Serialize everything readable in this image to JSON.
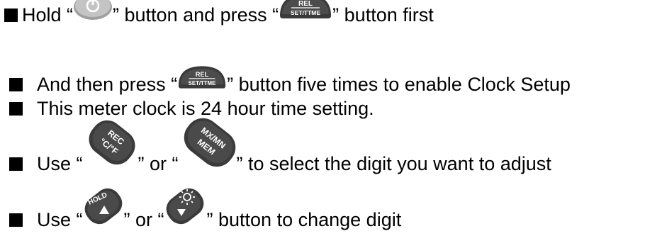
{
  "steps": [
    {
      "prefix": "Hold “",
      "button_1": "power",
      "middle": "” button and press “",
      "button_2": "rel-set-ttme",
      "suffix": "” button first"
    },
    {
      "prefix": "And then press “",
      "button_1": "rel-set-ttme",
      "suffix": "” button five times to enable Clock Setup"
    },
    {
      "text": "This meter clock is 24 hour time setting."
    },
    {
      "prefix": "Use “",
      "button_1": "rec-cf",
      "middle": "” or “",
      "button_2": "mxmn-mem",
      "suffix": "” to select the digit you want to adjust"
    },
    {
      "prefix": "Use “",
      "button_1": "hold-up",
      "middle": "” or “",
      "button_2": "backlight-down",
      "suffix": "” button to change digit"
    }
  ],
  "button_labels": {
    "rel": "REL",
    "set_ttme": "SET/TTME",
    "rec": "REC",
    "cf": "°C/°F",
    "mxmn": "MX/MN",
    "mem": "MEM",
    "hold": "HOLD"
  },
  "colors": {
    "text": "#000000",
    "power_button": "#b8b8b8",
    "power_symbol": "#ffffff",
    "keypad_button": "#3c3c3c",
    "keypad_label": "#ffffff"
  }
}
